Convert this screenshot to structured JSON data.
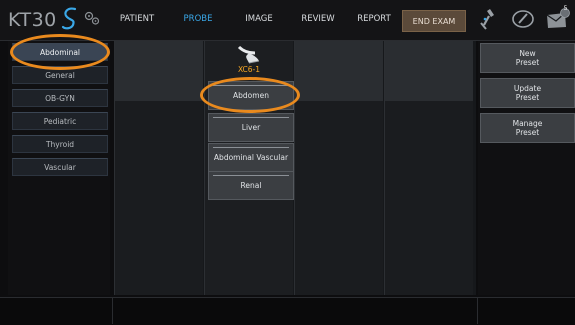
{
  "app": {
    "logo_text": "KT30"
  },
  "tabs": [
    {
      "label": "PATIENT"
    },
    {
      "label": "PROBE",
      "active": true
    },
    {
      "label": "IMAGE"
    },
    {
      "label": "REVIEW"
    },
    {
      "label": "REPORT"
    }
  ],
  "end_exam_label": "END EXAM",
  "notification_count": "5",
  "sidebar": {
    "items": [
      {
        "label": "Abdominal",
        "active": true
      },
      {
        "label": "General"
      },
      {
        "label": "OB-GYN"
      },
      {
        "label": "Pediatric"
      },
      {
        "label": "Thyroid"
      },
      {
        "label": "Vascular"
      }
    ]
  },
  "probe": {
    "name": "XC6-1",
    "presets": [
      {
        "label": "Abdomen",
        "active": true
      },
      {
        "label": "Liver"
      },
      {
        "label": "Abdominal Vascular"
      },
      {
        "label": "Renal"
      }
    ]
  },
  "right_panel": {
    "new_preset": "New\nPreset",
    "update_preset": "Update\nPreset",
    "manage_preset": "Manage\nPreset"
  },
  "colors": {
    "accent": "#3aa8e8",
    "highlight": "#e98a1e",
    "probe_name": "#f5a623"
  }
}
